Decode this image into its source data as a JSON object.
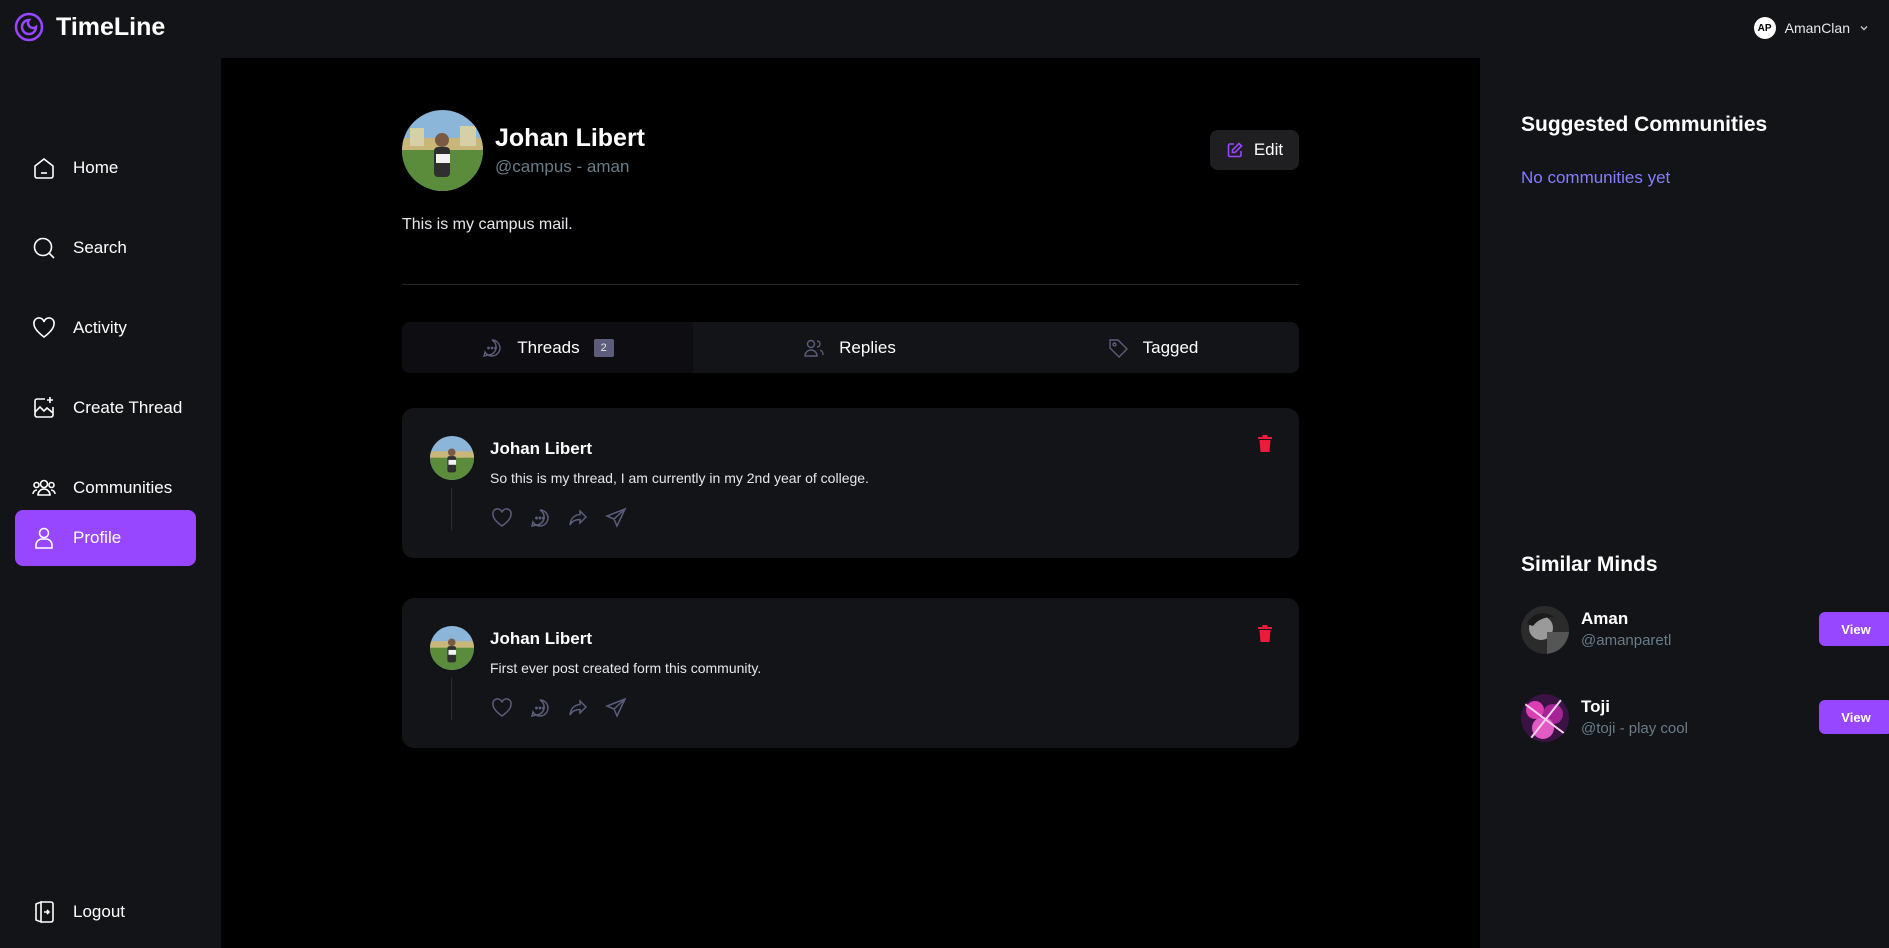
{
  "app": {
    "title": "TimeLine",
    "accent": "#9747ff"
  },
  "account": {
    "initials": "AP",
    "name": "AmanClan"
  },
  "sidebar": {
    "items": [
      {
        "label": "Home",
        "icon": "home-icon"
      },
      {
        "label": "Search",
        "icon": "search-icon"
      },
      {
        "label": "Activity",
        "icon": "heart-icon"
      },
      {
        "label": "Create Thread",
        "icon": "create-thread-icon"
      },
      {
        "label": "Communities",
        "icon": "communities-icon"
      },
      {
        "label": "Profile",
        "icon": "user-icon",
        "active": true
      }
    ],
    "logout": "Logout"
  },
  "profile": {
    "name": "Johan Libert",
    "handle": "@campus - aman",
    "bio": "This is my campus mail.",
    "edit_label": "Edit"
  },
  "tabs": [
    {
      "label": "Threads",
      "count": "2",
      "icon": "threads-icon",
      "active": true
    },
    {
      "label": "Replies",
      "icon": "replies-icon"
    },
    {
      "label": "Tagged",
      "icon": "tag-icon"
    }
  ],
  "threads": [
    {
      "author": "Johan Libert",
      "text": "So this is my thread, I am currently in my 2nd year of college."
    },
    {
      "author": "Johan Libert",
      "text": "First ever post created form this community."
    }
  ],
  "right": {
    "suggested_title": "Suggested Communities",
    "suggested_empty": "No communities yet",
    "similar_title": "Similar Minds",
    "users": [
      {
        "name": "Aman",
        "handle": "@amanparetl",
        "button": "View"
      },
      {
        "name": "Toji",
        "handle": "@toji - play cool",
        "button": "View"
      }
    ]
  }
}
